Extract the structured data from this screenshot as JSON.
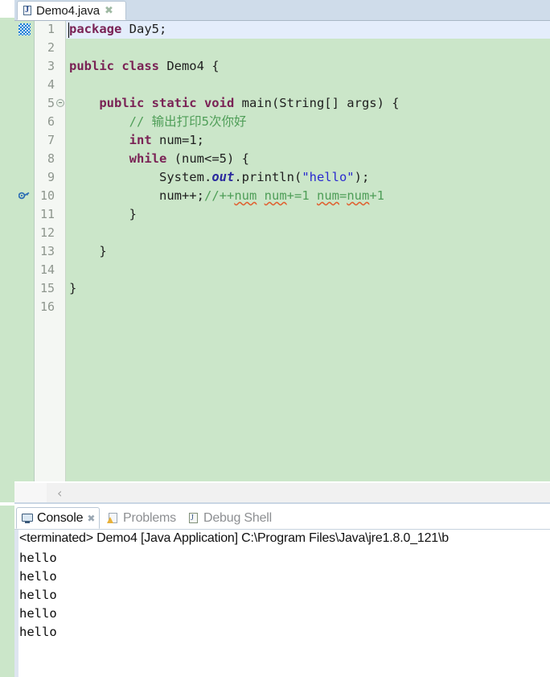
{
  "editor": {
    "tab": {
      "label": "Demo4.java",
      "icon": "java-file-icon",
      "close": "✖"
    },
    "lines": [
      {
        "n": 1,
        "fold": false,
        "marker": null
      },
      {
        "n": 2,
        "fold": false,
        "marker": null
      },
      {
        "n": 3,
        "fold": false,
        "marker": null
      },
      {
        "n": 4,
        "fold": false,
        "marker": null
      },
      {
        "n": 5,
        "fold": true,
        "marker": null
      },
      {
        "n": 6,
        "fold": false,
        "marker": null
      },
      {
        "n": 7,
        "fold": false,
        "marker": null
      },
      {
        "n": 8,
        "fold": false,
        "marker": null
      },
      {
        "n": 9,
        "fold": false,
        "marker": null
      },
      {
        "n": 10,
        "fold": false,
        "marker": "key-marker"
      },
      {
        "n": 11,
        "fold": false,
        "marker": null
      },
      {
        "n": 12,
        "fold": false,
        "marker": null
      },
      {
        "n": 13,
        "fold": false,
        "marker": null
      },
      {
        "n": 14,
        "fold": false,
        "marker": null
      },
      {
        "n": 15,
        "fold": false,
        "marker": null
      },
      {
        "n": 16,
        "fold": false,
        "marker": null
      }
    ],
    "code": {
      "l1": "package Day5;",
      "l3": "public class Demo4 {",
      "l5": "    public static void main(String[] args) {",
      "l6": "        // 输出打印5次你好",
      "l7": "        int num=1;",
      "l8": "        while (num<=5) {",
      "l9": "            System.out.println(\"hello\");",
      "l10": "            num++;//++num num+=1 num=num+1",
      "l11": "        }",
      "l13": "    }",
      "l15": "}"
    },
    "scrollbar": {
      "left_arrow": "‹"
    },
    "colors": {
      "background": "#cbe6c9",
      "keyword": "#7a2255",
      "comment": "#4f9e58",
      "string": "#2a2ad0",
      "field": "#2b2b9e",
      "current_line": "#e4edfb",
      "squiggle": "#e06030"
    }
  },
  "console": {
    "tabs": [
      {
        "label": "Console",
        "icon": "console-icon",
        "active": true,
        "closable": true,
        "close": "✖"
      },
      {
        "label": "Problems",
        "icon": "problems-icon",
        "active": false,
        "closable": false,
        "close": ""
      },
      {
        "label": "Debug Shell",
        "icon": "shell-icon",
        "active": false,
        "closable": false,
        "close": ""
      }
    ],
    "launch_line": "<terminated> Demo4 [Java Application] C:\\Program Files\\Java\\jre1.8.0_121\\b",
    "output": [
      "hello",
      "hello",
      "hello",
      "hello",
      "hello"
    ]
  }
}
